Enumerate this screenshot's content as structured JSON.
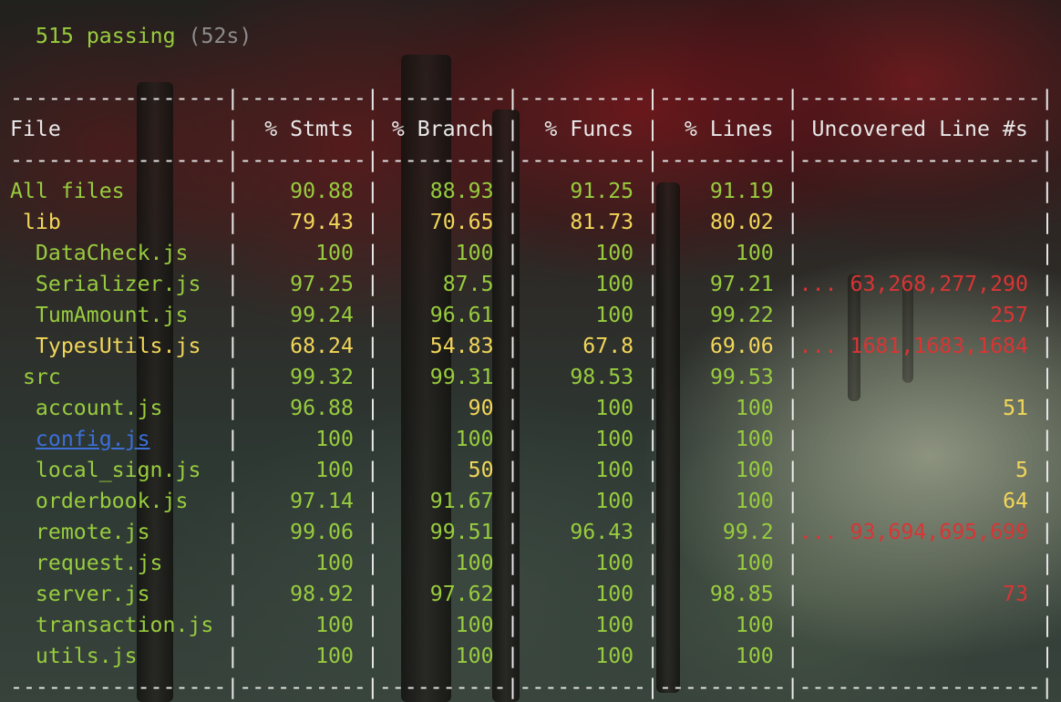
{
  "summary": {
    "passing": "515 passing",
    "duration": "(52s)"
  },
  "table": {
    "border_line": "-----------------|----------|----------|----------|----------|-------------------|",
    "header_line": "File             |  % Stmts | % Branch |  % Funcs |  % Lines | Uncovered Line #s |",
    "rows": [
      {
        "file": "All files",
        "stmts": "90.88",
        "branch": "88.93",
        "funcs": "91.25",
        "lines": "91.19",
        "uncovered": "",
        "indent": 0,
        "level": "high"
      },
      {
        "file": "lib",
        "stmts": "79.43",
        "branch": "70.65",
        "funcs": "81.73",
        "lines": "80.02",
        "uncovered": "",
        "indent": 1,
        "level": "medium"
      },
      {
        "file": "DataCheck.js",
        "stmts": "100",
        "branch": "100",
        "funcs": "100",
        "lines": "100",
        "uncovered": "",
        "indent": 2,
        "level": "high"
      },
      {
        "file": "Serializer.js",
        "stmts": "97.25",
        "branch": "87.5",
        "funcs": "100",
        "lines": "97.21",
        "uncovered": "... 63,268,277,290",
        "indent": 2,
        "level": "high"
      },
      {
        "file": "TumAmount.js",
        "stmts": "99.24",
        "branch": "96.61",
        "funcs": "100",
        "lines": "99.22",
        "uncovered": "257",
        "indent": 2,
        "level": "high"
      },
      {
        "file": "TypesUtils.js",
        "stmts": "68.24",
        "branch": "54.83",
        "funcs": "67.8",
        "lines": "69.06",
        "uncovered": "... 1681,1683,1684",
        "indent": 2,
        "level": "medium"
      },
      {
        "file": "src",
        "stmts": "99.32",
        "branch": "99.31",
        "funcs": "98.53",
        "lines": "99.53",
        "uncovered": "",
        "indent": 1,
        "level": "high"
      },
      {
        "file": "account.js",
        "stmts": "96.88",
        "branch": "90",
        "funcs": "100",
        "lines": "100",
        "uncovered": "51",
        "indent": 2,
        "level": "high"
      },
      {
        "file": "config.js",
        "stmts": "100",
        "branch": "100",
        "funcs": "100",
        "lines": "100",
        "uncovered": "",
        "indent": 2,
        "level": "high",
        "link": true
      },
      {
        "file": "local_sign.js",
        "stmts": "100",
        "branch": "50",
        "funcs": "100",
        "lines": "100",
        "uncovered": "5",
        "indent": 2,
        "level": "high"
      },
      {
        "file": "orderbook.js",
        "stmts": "97.14",
        "branch": "91.67",
        "funcs": "100",
        "lines": "100",
        "uncovered": "64",
        "indent": 2,
        "level": "high"
      },
      {
        "file": "remote.js",
        "stmts": "99.06",
        "branch": "99.51",
        "funcs": "96.43",
        "lines": "99.2",
        "uncovered": "... 93,694,695,699",
        "indent": 2,
        "level": "high"
      },
      {
        "file": "request.js",
        "stmts": "100",
        "branch": "100",
        "funcs": "100",
        "lines": "100",
        "uncovered": "",
        "indent": 2,
        "level": "high"
      },
      {
        "file": "server.js",
        "stmts": "98.92",
        "branch": "97.62",
        "funcs": "100",
        "lines": "98.85",
        "uncovered": "73",
        "indent": 2,
        "level": "high"
      },
      {
        "file": "transaction.js",
        "stmts": "100",
        "branch": "100",
        "funcs": "100",
        "lines": "100",
        "uncovered": "",
        "indent": 2,
        "level": "high"
      },
      {
        "file": "utils.js",
        "stmts": "100",
        "branch": "100",
        "funcs": "100",
        "lines": "100",
        "uncovered": "",
        "indent": 2,
        "level": "high"
      }
    ]
  },
  "colors": {
    "high": "#98cc3e",
    "medium": "#f2d65a",
    "low": "#d83535",
    "separator": "#e8e8e8",
    "link": "#3c6fd8"
  },
  "cell_colors": {
    "branch_overrides": {
      "account.js": "#f2d65a",
      "local_sign.js": "#f2d65a"
    },
    "uncovered_colors": {
      "Serializer.js": "#d83535",
      "TumAmount.js": "#d83535",
      "TypesUtils.js": "#d83535",
      "account.js": "#f2d65a",
      "local_sign.js": "#f2d65a",
      "orderbook.js": "#f2d65a",
      "remote.js": "#d83535",
      "server.js": "#d83535"
    }
  }
}
